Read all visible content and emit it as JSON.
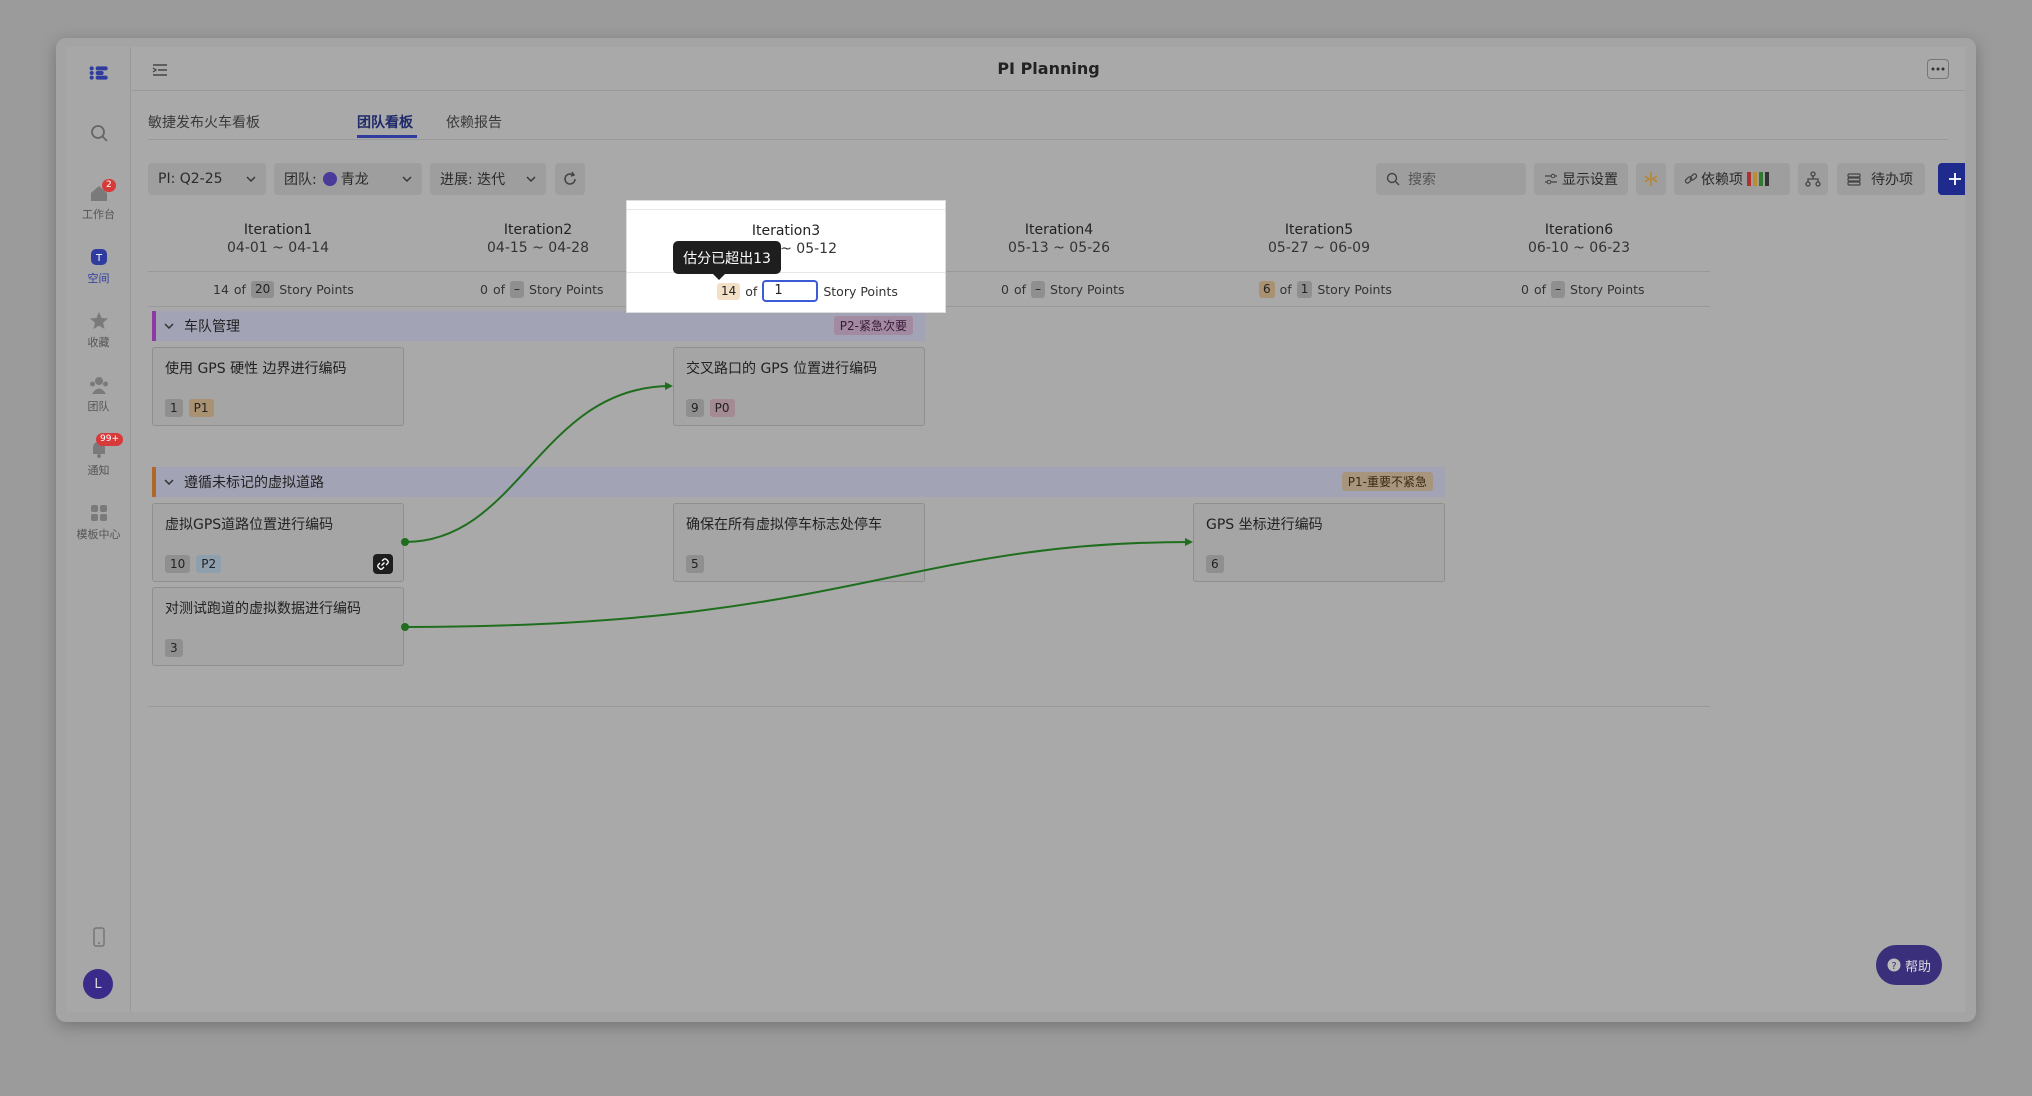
{
  "app": {
    "title": "PI Planning"
  },
  "sidebar": {
    "items": [
      {
        "label": "工作台",
        "badge": "2"
      },
      {
        "label": "空间"
      },
      {
        "label": "收藏"
      },
      {
        "label": "团队"
      },
      {
        "label": "通知",
        "badge": "99+"
      },
      {
        "label": "模板中心"
      }
    ],
    "avatar": "L"
  },
  "tabs": [
    {
      "label": "敏捷发布火车看板"
    },
    {
      "label": "团队看板"
    },
    {
      "label": "依赖报告"
    }
  ],
  "toolbar": {
    "pi": "PI:  Q2-25",
    "team_prefix": "团队:",
    "team_value": "青龙",
    "progress": "进展: 迭代",
    "search_placeholder": "搜索",
    "display_settings": "显示设置",
    "dependencies": "依赖项",
    "todo": "待办项",
    "new": "新建"
  },
  "iterations": [
    {
      "name": "Iteration1",
      "dates": "04-01 ~ 04-14",
      "used": "14",
      "of": "of",
      "capacity": "20",
      "unit": "Story Points"
    },
    {
      "name": "Iteration2",
      "dates": "04-15 ~ 04-28",
      "used": "0",
      "of": "of",
      "capacity": "–",
      "unit": "Story Points"
    },
    {
      "name": "Iteration3",
      "dates": "04-29 ~ 05-12",
      "used": "14",
      "of": "of",
      "capacity": "1",
      "unit": "Story Points"
    },
    {
      "name": "Iteration4",
      "dates": "05-13 ~ 05-26",
      "used": "0",
      "of": "of",
      "capacity": "–",
      "unit": "Story Points"
    },
    {
      "name": "Iteration5",
      "dates": "05-27 ~ 06-09",
      "used": "6",
      "of": "of",
      "capacity": "1",
      "unit": "Story Points"
    },
    {
      "name": "Iteration6",
      "dates": "06-10 ~ 06-23",
      "used": "0",
      "of": "of",
      "capacity": "–",
      "unit": "Story Points"
    }
  ],
  "tooltip": "估分已超出13",
  "groups": [
    {
      "name": "车队管理",
      "tag": "P2-紧急次要",
      "cards": [
        {
          "title": "使用 GPS 硬性 边界进行编码",
          "points": "1",
          "priority": "P1"
        },
        {
          "title": "交叉路口的 GPS 位置进行编码",
          "points": "9",
          "priority": "P0"
        }
      ]
    },
    {
      "name": "遵循未标记的虚拟道路",
      "tag": "P1-重要不紧急",
      "cards": [
        {
          "title": "虚拟GPS道路位置进行编码",
          "points": "10",
          "priority": "P2"
        },
        {
          "title": "确保在所有虚拟停车标志处停车",
          "points": "5"
        },
        {
          "title": "GPS 坐标进行编码",
          "points": "6"
        },
        {
          "title": "对测试跑道的虚拟数据进行编码",
          "points": "3"
        }
      ]
    }
  ],
  "help": "帮助",
  "colors": {
    "accent": "#1f2b8c",
    "dependency_line": "#1f6e1f",
    "input_focus": "#3c5bd6"
  }
}
